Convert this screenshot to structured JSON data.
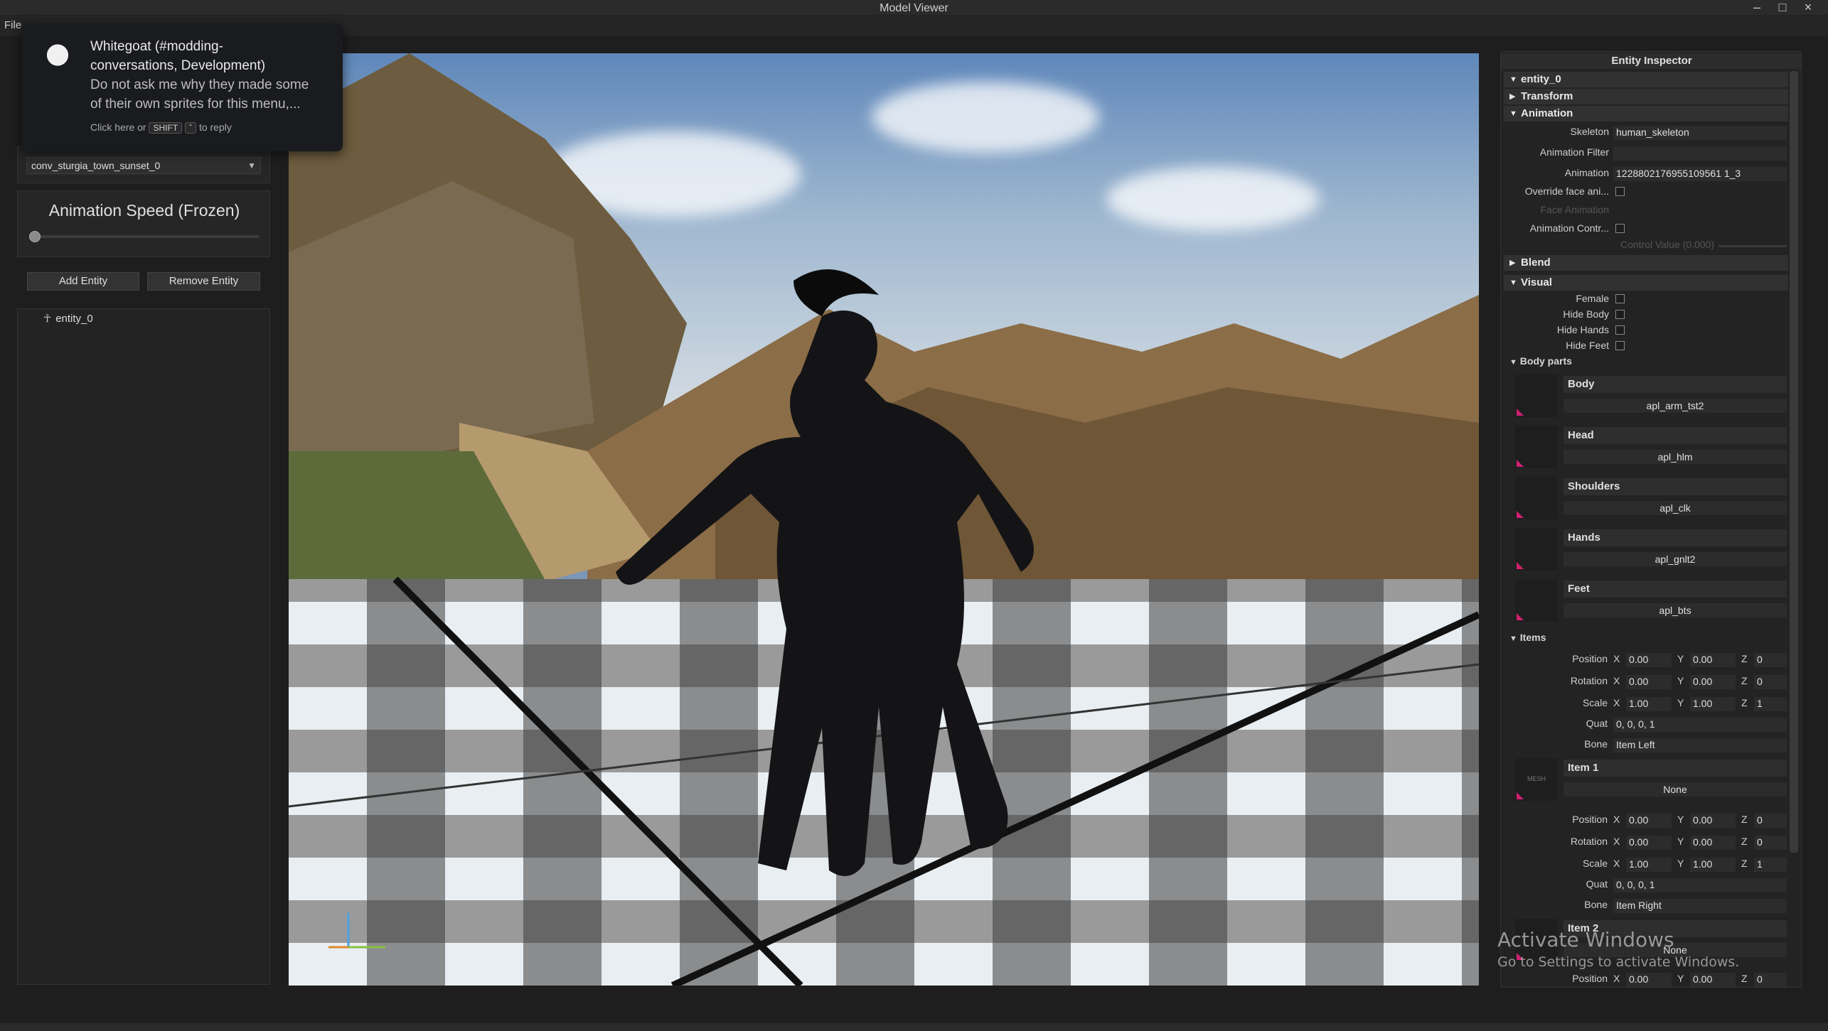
{
  "window": {
    "title": "Model Viewer",
    "minimize": "–",
    "maximize": "□",
    "close": "×"
  },
  "menu": {
    "file": "File"
  },
  "toast": {
    "line1": "Whitegoat (#modding-",
    "line2": "conversations, Development)",
    "line3": "Do not ask me why they made some",
    "line4": "of their own sprites for this menu,...",
    "hint_pre": "Click here or",
    "hint_key": "SHIFT",
    "hint_key2": "ˆ",
    "hint_post": "to reply"
  },
  "left": {
    "scene_select": "conv_sturgia_town_sunset_0",
    "speed_title": "Animation Speed (Frozen)",
    "speed_level": 0.0,
    "add_entity": "Add Entity",
    "remove_entity": "Remove Entity",
    "entities": [
      "entity_0"
    ]
  },
  "inspector": {
    "title": "Entity Inspector",
    "entity": "entity_0",
    "sections": {
      "transform": "Transform",
      "animation": "Animation",
      "blend": "Blend",
      "visual": "Visual",
      "body_parts": "Body parts",
      "items": "Items"
    },
    "animation": {
      "skeleton_label": "Skeleton",
      "skeleton": "human_skeleton",
      "filter_label": "Animation Filter",
      "filter": "",
      "anim_label": "Animation",
      "anim": "1228802176955109561 1_3",
      "override_label": "Override face ani...",
      "face_anim_label": "Face Animation",
      "control_label": "Animation Contr...",
      "control_value_label": "Control Value (0.000)"
    },
    "visual": {
      "female": "Female",
      "hide_body": "Hide Body",
      "hide_hands": "Hide Hands",
      "hide_feet": "Hide Feet"
    },
    "body_parts": [
      {
        "name": "Body",
        "mesh": "apl_arm_tst2"
      },
      {
        "name": "Head",
        "mesh": "apl_hlm"
      },
      {
        "name": "Shoulders",
        "mesh": "apl_clk"
      },
      {
        "name": "Hands",
        "mesh": "apl_gnlt2"
      },
      {
        "name": "Feet",
        "mesh": "apl_bts"
      }
    ],
    "labels": {
      "position": "Position",
      "rotation": "Rotation",
      "scale": "Scale",
      "quat": "Quat",
      "bone": "Bone",
      "x": "X",
      "y": "Y",
      "z": "Z",
      "mesh_thumb": "MESH"
    },
    "item_left": {
      "pos": [
        "0.00",
        "0.00",
        "0"
      ],
      "rot": [
        "0.00",
        "0.00",
        "0"
      ],
      "scale": [
        "1.00",
        "1.00",
        "1"
      ],
      "quat": "0, 0, 0, 1",
      "bone": "Item Left"
    },
    "item1": {
      "name": "Item 1",
      "mesh": "None",
      "pos": [
        "0.00",
        "0.00",
        "0"
      ],
      "rot": [
        "0.00",
        "0.00",
        "0"
      ],
      "scale": [
        "1.00",
        "1.00",
        "1"
      ],
      "quat": "0, 0, 0, 1",
      "bone": "Item Right"
    },
    "item2": {
      "name": "Item 2",
      "mesh": "None",
      "pos": [
        "0.00",
        "0.00",
        "0"
      ]
    }
  },
  "watermark": {
    "line1": "Activate Windows",
    "line2": "Go to Settings to activate Windows."
  }
}
